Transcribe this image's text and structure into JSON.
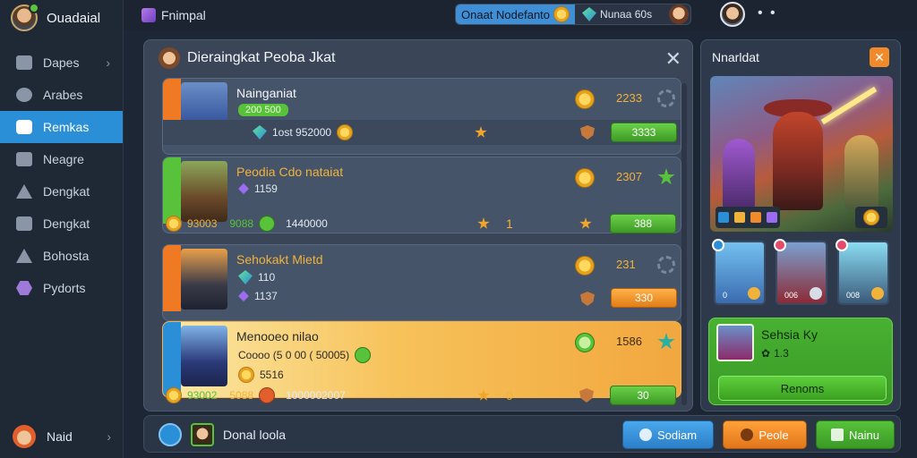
{
  "sidebar": {
    "brand": "Ouadaial",
    "items": [
      {
        "label": "Dapes",
        "chevron": true
      },
      {
        "label": "Arabes",
        "chevron": false
      },
      {
        "label": "Remkas",
        "chevron": false,
        "active": true
      },
      {
        "label": "Neagre",
        "chevron": false
      },
      {
        "label": "Dengkat",
        "chevron": false
      },
      {
        "label": "Dengkat",
        "chevron": false
      },
      {
        "label": "Bohosta",
        "chevron": false
      },
      {
        "label": "Pydorts",
        "chevron": false
      }
    ],
    "user": "Naid"
  },
  "topbar": {
    "title": "Fnimpal",
    "pill_label": "Onaat Nodefanto",
    "pill_value": "Nunaa 60s"
  },
  "main": {
    "title": "Dieraingkat Peoba Jkat",
    "cards": [
      {
        "name": "Nainganiat",
        "badge": "200  500",
        "value": "2233",
        "row_text": "1ost 952000",
        "button": "3333",
        "button_color": "green"
      },
      {
        "name": "Peodia Cdo nataiat",
        "sub": "1159",
        "value": "2307",
        "button": "388",
        "button_color": "green"
      },
      {
        "name": "Sehokakt Mietd",
        "sub": "110",
        "sub2": "1137",
        "value": "231",
        "button": "330",
        "button_color": "orange"
      },
      {
        "name": "Menooeo nilao",
        "sub": "Coooo (5 0 00 ( 50005)",
        "sub2": "5516",
        "value": "1586",
        "highlight": true
      }
    ],
    "summary1": {
      "a": "93003",
      "b": "9088",
      "c": "1440000",
      "count": "1",
      "button": "388"
    },
    "summary2": {
      "a": "93002",
      "b": "5088",
      "c": "1000002007",
      "count": "0",
      "button": "30"
    }
  },
  "right": {
    "title": "Nnarldat",
    "close": "✕",
    "heroes": [
      {
        "label": "0"
      },
      {
        "label": "006"
      },
      {
        "label": "008"
      }
    ],
    "feature_title": "Sehsia Ky",
    "feature_sub": "1.3",
    "feature_button": "Renoms"
  },
  "bottombar": {
    "name": "Donal loola",
    "buttons": [
      "Sodiam",
      "Peole",
      "Nainu"
    ]
  },
  "colors": {
    "accent_blue": "#2a8fd6",
    "accent_green": "#58c23a",
    "accent_orange": "#f08a2a",
    "gold": "#f1b23a"
  }
}
